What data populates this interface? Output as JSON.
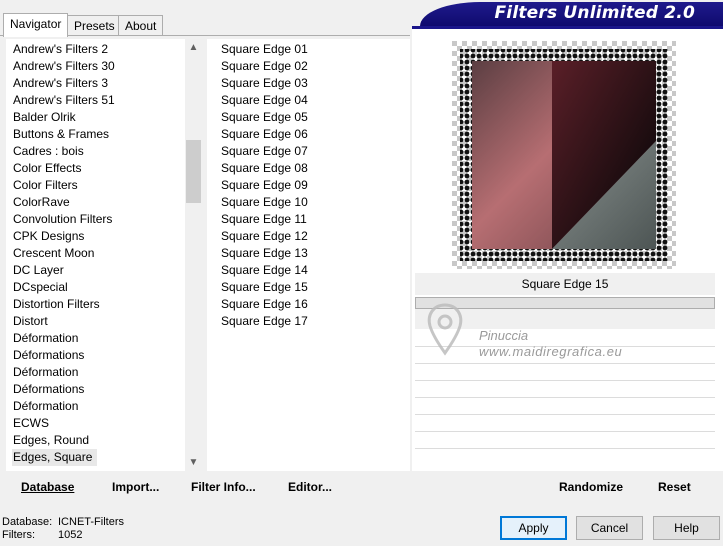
{
  "tabs": [
    {
      "label": "Navigator",
      "active": true
    },
    {
      "label": "Presets",
      "active": false
    },
    {
      "label": "About",
      "active": false
    }
  ],
  "banner": {
    "title": "Filters Unlimited 2.0",
    "color": "#15108a"
  },
  "categories": [
    "Andrew's Filters 2",
    "Andrew's Filters 30",
    "Andrew's Filters 3",
    "Andrew's Filters 51",
    "Balder Olrik",
    "Buttons & Frames",
    "Cadres : bois",
    "Color Effects",
    "Color Filters",
    "ColorRave",
    "Convolution Filters",
    "CPK Designs",
    "Crescent Moon",
    "DC Layer",
    "DCspecial",
    "Distortion Filters",
    "Distort",
    "Déformation",
    "Déformations",
    "Déformation",
    "Déformations",
    "Déformation",
    "ECWS",
    "Edges, Round",
    "Edges, Square"
  ],
  "selected_category": "Edges, Square",
  "filters": [
    "Square Edge 01",
    "Square Edge 02",
    "Square Edge 03",
    "Square Edge 04",
    "Square Edge 05",
    "Square Edge 06",
    "Square Edge 07",
    "Square Edge 08",
    "Square Edge 09",
    "Square Edge 10",
    "Square Edge 11",
    "Square Edge 12",
    "Square Edge 13",
    "Square Edge 14",
    "Square Edge 15",
    "Square Edge 16",
    "Square Edge 17"
  ],
  "preview": {
    "caption": "Square Edge 15"
  },
  "watermark": {
    "line1": "Pinuccia",
    "line2": "www.maidiregrafica.eu"
  },
  "toolbar": {
    "database": "Database",
    "import": "Import...",
    "filter_info": "Filter Info...",
    "editor": "Editor...",
    "randomize": "Randomize",
    "reset": "Reset"
  },
  "status": {
    "database_label": "Database:",
    "database_value": "ICNET-Filters",
    "filters_label": "Filters:",
    "filters_value": "1052"
  },
  "buttons": {
    "apply": "Apply",
    "cancel": "Cancel",
    "help": "Help"
  },
  "icons": {
    "scroll_up": "chevron-up-icon",
    "scroll_down": "chevron-down-icon"
  }
}
